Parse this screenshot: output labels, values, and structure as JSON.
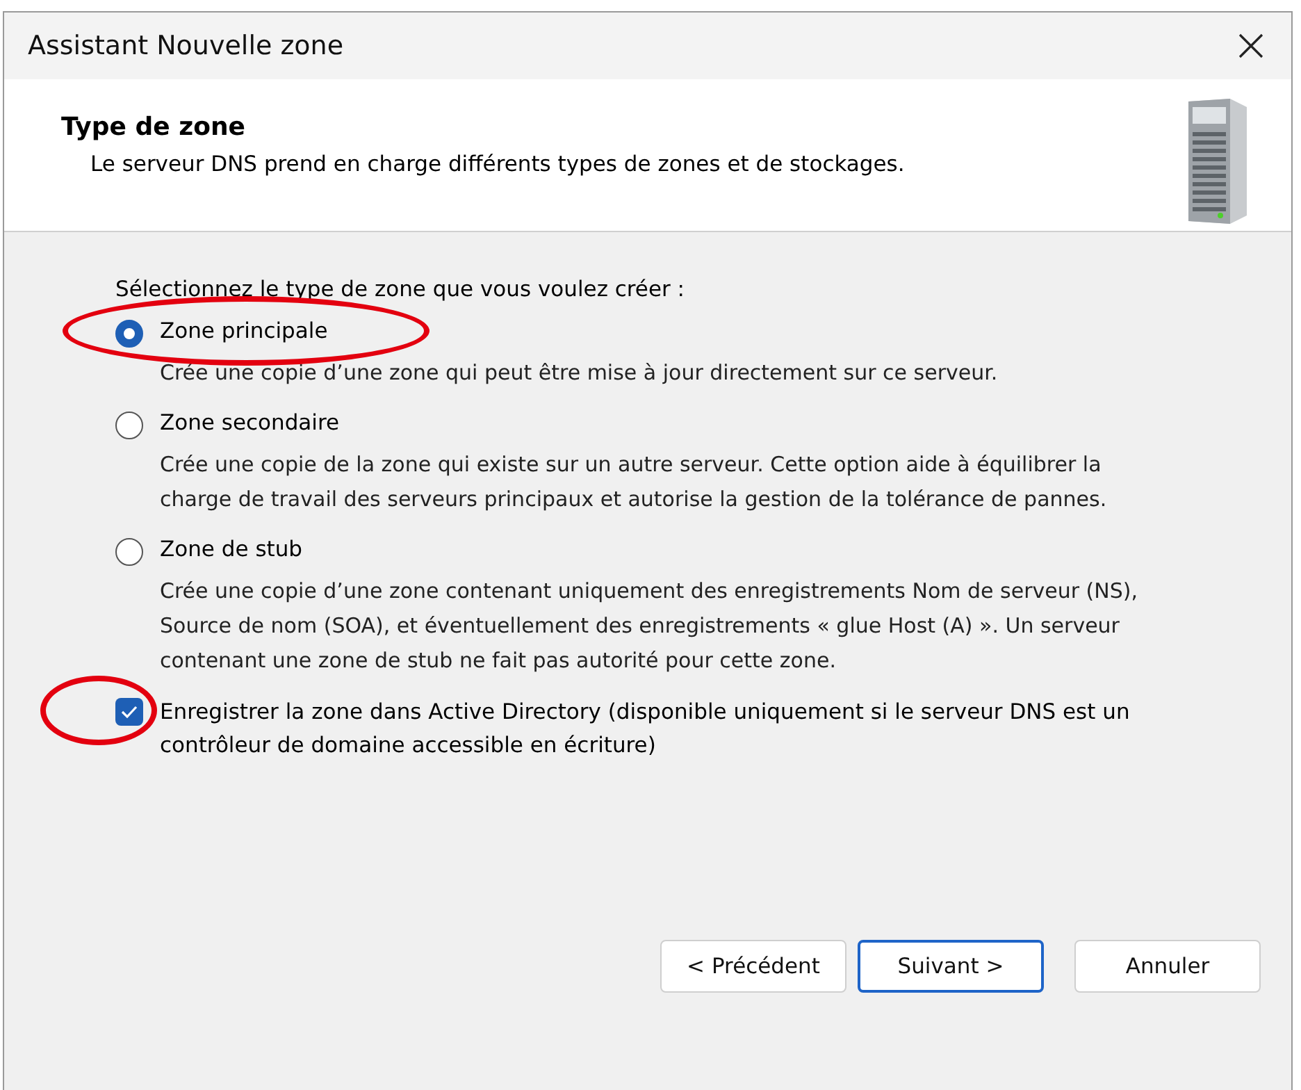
{
  "window": {
    "title": "Assistant Nouvelle zone"
  },
  "header": {
    "title": "Type de zone",
    "subtitle": "Le serveur DNS prend en charge différents types de zones et de stockages."
  },
  "prompt": "Sélectionnez le type de zone que vous voulez créer :",
  "zone_types": [
    {
      "label": "Zone principale",
      "description": "Crée une copie d’une zone qui peut être mise à jour directement sur ce serveur.",
      "selected": true,
      "highlighted": true
    },
    {
      "label": "Zone secondaire",
      "description": "Crée une copie de la zone qui existe sur un autre serveur. Cette option aide à équilibrer la charge de travail des serveurs principaux et autorise la gestion de la tolérance de pannes.",
      "selected": false,
      "highlighted": false
    },
    {
      "label": "Zone de stub",
      "description": "Crée une copie d’une zone contenant uniquement des enregistrements Nom de serveur (NS), Source de nom (SOA), et éventuellement des enregistrements « glue Host (A) ». Un serveur contenant une zone de stub ne fait pas autorité pour cette zone.",
      "selected": false,
      "highlighted": false
    }
  ],
  "store_in_ad": {
    "label": "Enregistrer la zone dans Active Directory (disponible uniquement si le serveur DNS est un contrôleur de domaine accessible en écriture)",
    "checked": true,
    "highlighted": true
  },
  "buttons": [
    {
      "label": "< Précédent",
      "default": false
    },
    {
      "label": "Suivant >",
      "default": true
    },
    {
      "label": "Annuler",
      "default": false
    }
  ]
}
